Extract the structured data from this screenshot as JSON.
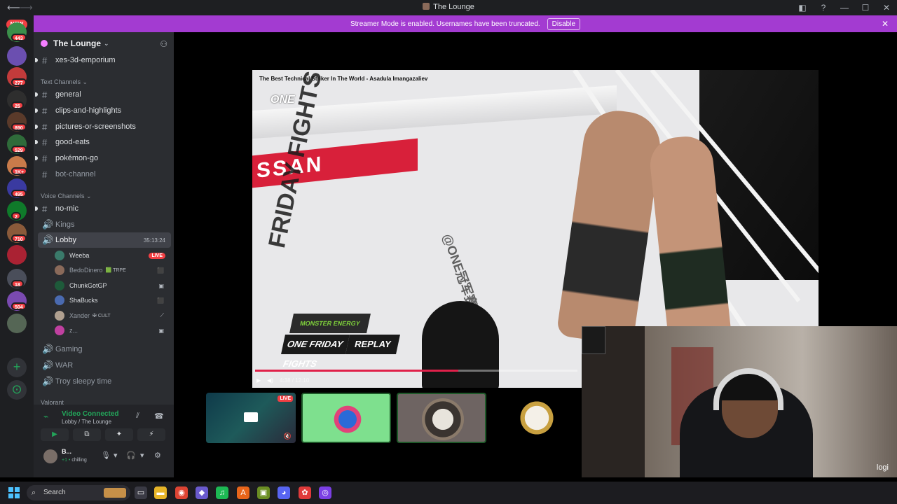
{
  "window": {
    "title": "The Lounge",
    "controls": [
      "◧",
      "?",
      "—",
      "☐",
      "✕"
    ]
  },
  "banner": {
    "text": "Streamer Mode is enabled. Usernames have been truncated.",
    "button": "Disable",
    "close": "✕"
  },
  "rail": {
    "new_label": "NEW",
    "servers": [
      {
        "color": "#3b8f4a",
        "badge": "443"
      },
      {
        "color": "#6b4fb0",
        "badge": ""
      },
      {
        "color": "#c33b3b",
        "badge": "277"
      },
      {
        "color": "#2e2e2e",
        "badge": "25"
      },
      {
        "color": "#5a3a2a",
        "badge": "890"
      },
      {
        "color": "#2f6b3a",
        "badge": "529"
      },
      {
        "color": "#c97b4a",
        "badge": "1K+"
      },
      {
        "color": "#3a3aa0",
        "badge": "495"
      },
      {
        "color": "#0f7a2a",
        "badge": "2"
      },
      {
        "color": "#8a5a3a",
        "badge": "710"
      },
      {
        "color": "#aa2233",
        "badge": ""
      },
      {
        "color": "#4a4e5a",
        "badge": "18"
      },
      {
        "color": "#7a4ab0",
        "badge": "504"
      },
      {
        "color": "#556655",
        "badge": ""
      }
    ],
    "add_label": "+",
    "explore_label": "⊙"
  },
  "sidebar": {
    "guild_name": "The Lounge",
    "channels_top": [
      {
        "name": "xes-3d-emporium",
        "unread": true
      }
    ],
    "text_category": "Text Channels",
    "text_channels": [
      {
        "name": "general",
        "unread": true
      },
      {
        "name": "clips-and-highlights",
        "unread": true
      },
      {
        "name": "pictures-or-screenshots",
        "unread": true
      },
      {
        "name": "good-eats",
        "unread": true
      },
      {
        "name": "pokémon-go",
        "unread": true
      },
      {
        "name": "bot-channel",
        "unread": false
      }
    ],
    "voice_category": "Voice Channels",
    "voice_channels_before": [
      {
        "name": "no-mic",
        "icon": "#",
        "unread": true
      },
      {
        "name": "Kings",
        "icon": "🔊",
        "unread": false
      }
    ],
    "lobby": {
      "name": "Lobby",
      "time": "35:13:24"
    },
    "voice_users": [
      {
        "name": "Weeba",
        "tag": "",
        "live": "LIVE",
        "color": "#3a7a6a",
        "dim": false
      },
      {
        "name": "BedoDinero",
        "tag": "🟩 TRPE",
        "live": "",
        "color": "#8a6a5a",
        "dim": true
      },
      {
        "name": "ChunkGotGP",
        "tag": "",
        "live": "",
        "color": "#1e5a3a",
        "dim": false
      },
      {
        "name": "ShaBucks",
        "tag": "",
        "live": "",
        "color": "#4a6ab0",
        "dim": false
      },
      {
        "name": "Xander",
        "tag": "✠ CULT",
        "live": "",
        "color": "#b0a090",
        "dim": true
      },
      {
        "name": "z...",
        "tag": "",
        "live": "",
        "color": "#c040a0",
        "dim": true
      }
    ],
    "voice_channels_after": [
      "Gaming",
      "WAR",
      "Troy sleepy time"
    ],
    "valorant_category": "Valorant"
  },
  "voice_panel": {
    "title": "Video Connected",
    "subtitle": "Lobby / The Lounge",
    "buttons": [
      "▶",
      "⧉",
      "✦",
      "⚡"
    ]
  },
  "user_panel": {
    "name": "B...",
    "status": "chilling",
    "status_prefix": "+1 •",
    "controls": [
      "🎙",
      "▾",
      "🎧",
      "▾",
      "⚙"
    ]
  },
  "stream": {
    "video_title": "The Best Technical Striker In The World - Asadula Imangazaliev",
    "logo": "ONE",
    "sponsor": "SSAN",
    "mat_text": "FRIDAY FIGHTS",
    "handle": "@ONE冠军赛",
    "overlay_brand": "MONSTER ENERGY",
    "overlay_event": "ONE FRIDAY FIGHTS",
    "overlay_replay": "REPLAY",
    "progress": 0.63,
    "time": "4:38 / 12:10"
  },
  "tiles": [
    {
      "kind": "screen",
      "live": "LIVE",
      "color": "#1e4a5a",
      "selected": false
    },
    {
      "kind": "avatar",
      "live": "",
      "color": "#7ee08e",
      "selected": true
    },
    {
      "kind": "avatar",
      "live": "",
      "color": "#6e6462",
      "selected": true
    },
    {
      "kind": "avatar",
      "live": "",
      "color": "#111111",
      "selected": false
    }
  ],
  "webcam": {
    "watermark": "logi"
  },
  "taskbar": {
    "search_label": "Search",
    "apps": [
      {
        "name": "file-explorer",
        "glyph": "▭",
        "color": "#3a3a44"
      },
      {
        "name": "folder",
        "glyph": "▬",
        "color": "#e6b428"
      },
      {
        "name": "chrome",
        "glyph": "◉",
        "color": "#dd4433"
      },
      {
        "name": "copilot",
        "glyph": "◆",
        "color": "#6a5acd"
      },
      {
        "name": "spotify",
        "glyph": "♫",
        "color": "#1db954"
      },
      {
        "name": "app-a",
        "glyph": "A",
        "color": "#e8651a"
      },
      {
        "name": "app-b",
        "glyph": "▣",
        "color": "#6b8e23"
      },
      {
        "name": "discord",
        "glyph": "◕",
        "color": "#5865f2"
      },
      {
        "name": "app-c",
        "glyph": "✿",
        "color": "#e03a3a"
      },
      {
        "name": "app-d",
        "glyph": "◎",
        "color": "#7b3fe4"
      }
    ]
  },
  "colors": {
    "accent": "#a33bd1",
    "live": "#f23f43",
    "connected": "#23a55a"
  }
}
